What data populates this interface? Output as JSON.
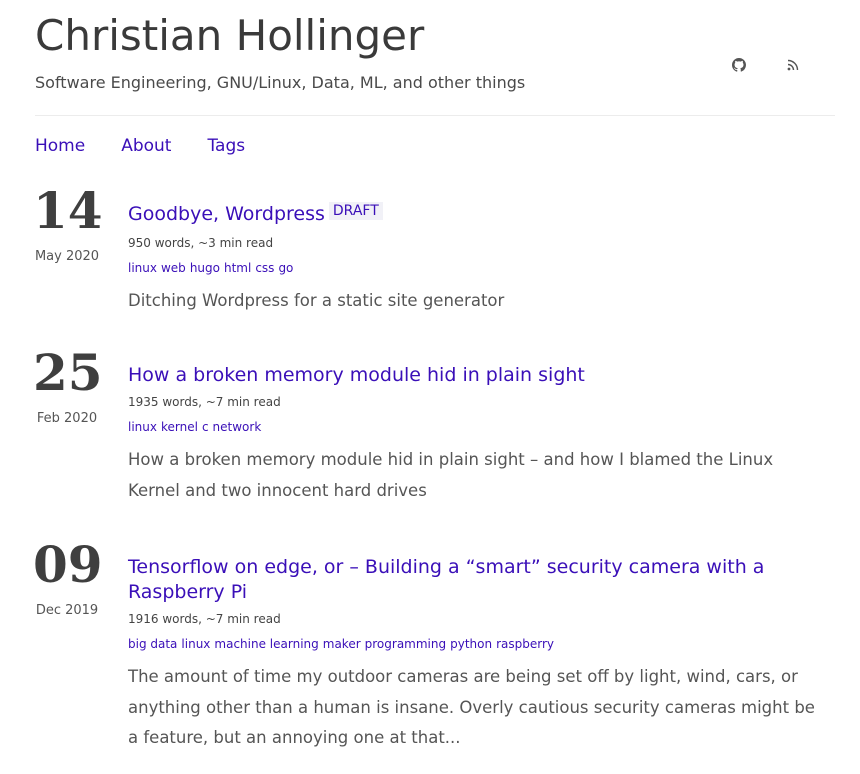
{
  "site": {
    "title": "Christian Hollinger",
    "subtitle": "Software Engineering, GNU/Linux, Data, ML, and other things",
    "social": [
      {
        "name": "github",
        "icon": "github-icon"
      },
      {
        "name": "rss",
        "icon": "rss-icon"
      }
    ]
  },
  "nav": {
    "items": [
      {
        "label": "Home"
      },
      {
        "label": "About"
      },
      {
        "label": "Tags"
      }
    ]
  },
  "posts": [
    {
      "day": "14",
      "month": "May 2020",
      "title": "Goodbye, Wordpress",
      "badge": "DRAFT",
      "meta": "950 words, ~3 min read",
      "tags": [
        "linux",
        "web",
        "hugo",
        "html",
        "css",
        "go"
      ],
      "summary": "Ditching Wordpress for a static site generator"
    },
    {
      "day": "25",
      "month": "Feb 2020",
      "title": "How a broken memory module hid in plain sight",
      "badge": "",
      "meta": "1935 words, ~7 min read",
      "tags": [
        "linux",
        "kernel",
        "c",
        "network"
      ],
      "summary": "How a broken memory module hid in plain sight – and how I blamed the Linux Kernel and two innocent hard drives"
    },
    {
      "day": "09",
      "month": "Dec 2019",
      "title": "Tensorflow on edge, or – Building a “smart” security camera with a Raspberry Pi",
      "badge": "",
      "meta": "1916 words, ~7 min read",
      "tags": [
        "big data",
        "linux",
        "machine learning",
        "maker",
        "programming",
        "python",
        "raspberry"
      ],
      "summary": "The amount of time my outdoor cameras are being set off by light, wind, cars, or anything other than a human is insane. Overly cautious security cameras might be a feature, but an annoying one at that..."
    }
  ],
  "colors": {
    "link": "#3a0fb8",
    "text": "#444444"
  }
}
